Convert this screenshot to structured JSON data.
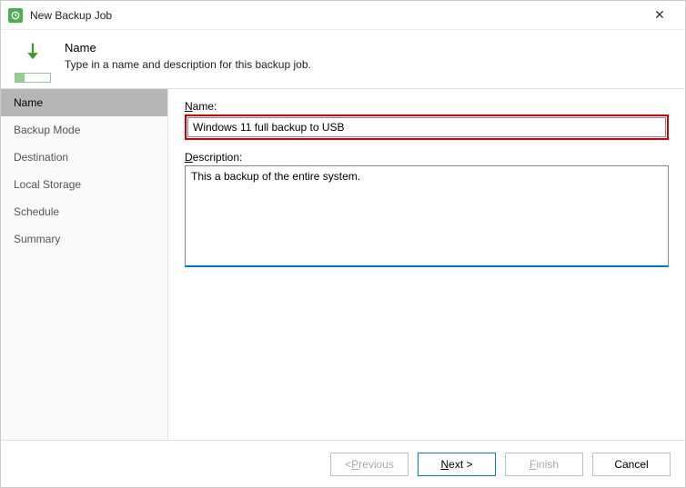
{
  "window": {
    "title": "New Backup Job"
  },
  "header": {
    "step_title": "Name",
    "step_subtitle": "Type in a name and description for this backup job."
  },
  "sidebar": {
    "items": [
      {
        "label": "Name",
        "active": true
      },
      {
        "label": "Backup Mode",
        "active": false
      },
      {
        "label": "Destination",
        "active": false
      },
      {
        "label": "Local Storage",
        "active": false
      },
      {
        "label": "Schedule",
        "active": false
      },
      {
        "label": "Summary",
        "active": false
      }
    ]
  },
  "form": {
    "name_label_pre": "N",
    "name_label_rest": "ame:",
    "name_value": "Windows 11 full backup to USB",
    "desc_label_pre": "D",
    "desc_label_rest": "escription:",
    "desc_value": "This a backup of the entire system."
  },
  "footer": {
    "previous_pre": "< ",
    "previous_u": "P",
    "previous_rest": "revious",
    "previous_enabled": false,
    "next_u": "N",
    "next_rest": "ext >",
    "next_enabled": true,
    "finish_u": "F",
    "finish_rest": "inish",
    "finish_enabled": false,
    "cancel": "Cancel",
    "cancel_enabled": true
  }
}
